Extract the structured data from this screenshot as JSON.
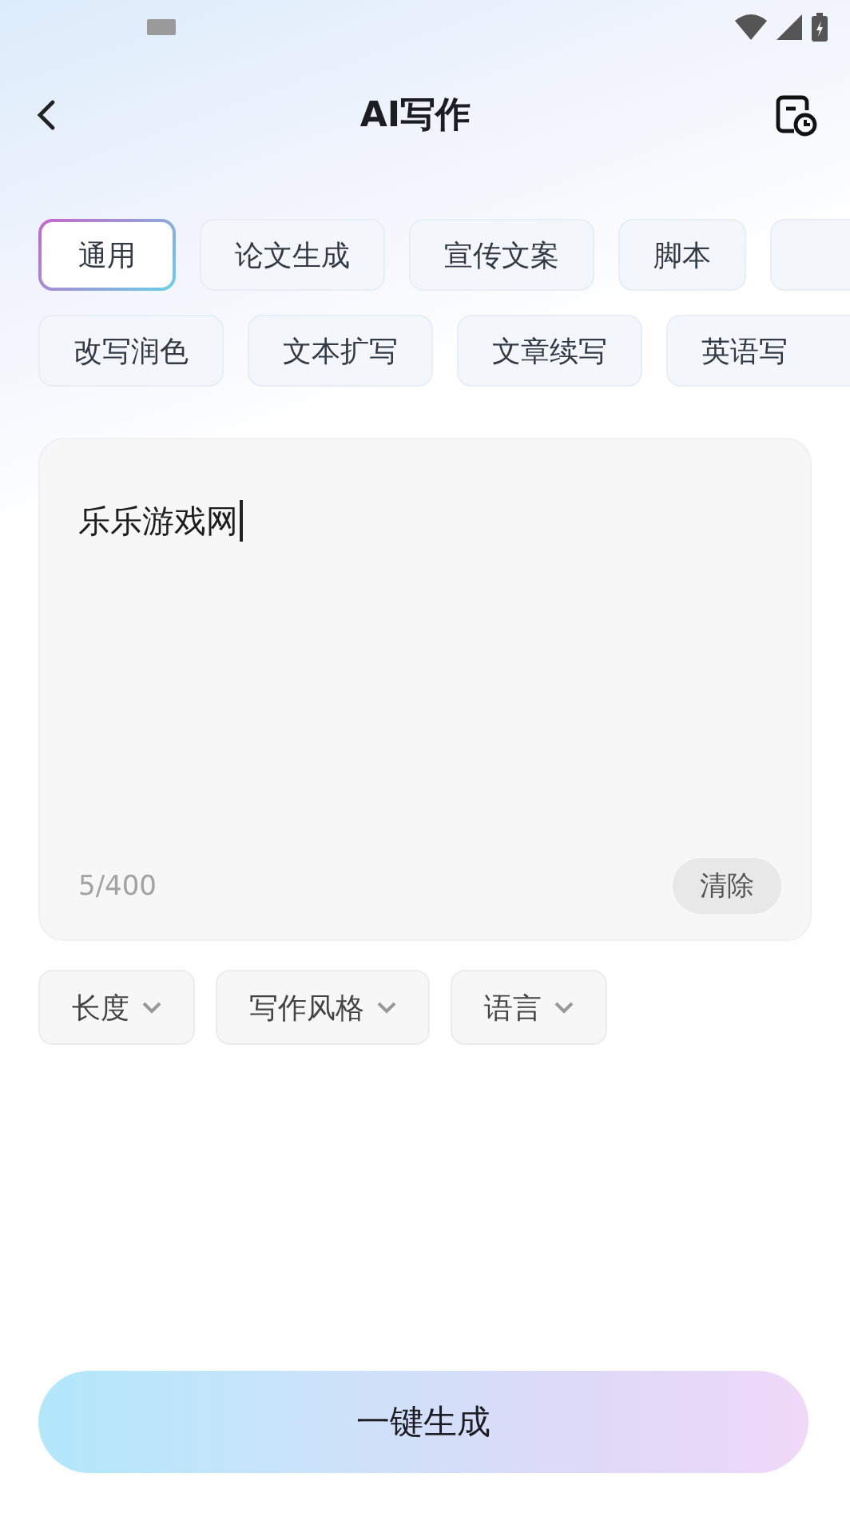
{
  "header": {
    "title": "AI写作"
  },
  "categories": [
    [
      {
        "label": "通用",
        "selected": true
      },
      {
        "label": "论文生成",
        "selected": false
      },
      {
        "label": "宣传文案",
        "selected": false
      },
      {
        "label": "脚本",
        "selected": false
      },
      {
        "selected": false
      }
    ],
    [
      {
        "label": "改写润色",
        "selected": false
      },
      {
        "label": "文本扩写",
        "selected": false
      },
      {
        "label": "文章续写",
        "selected": false
      },
      {
        "label": "英语写",
        "selected": false
      }
    ]
  ],
  "editor": {
    "value": "乐乐游戏网",
    "counter": "5/400",
    "clear_button": "清除"
  },
  "options": [
    "长度",
    "写作风格",
    "语言"
  ],
  "generate_button": "一键生成"
}
